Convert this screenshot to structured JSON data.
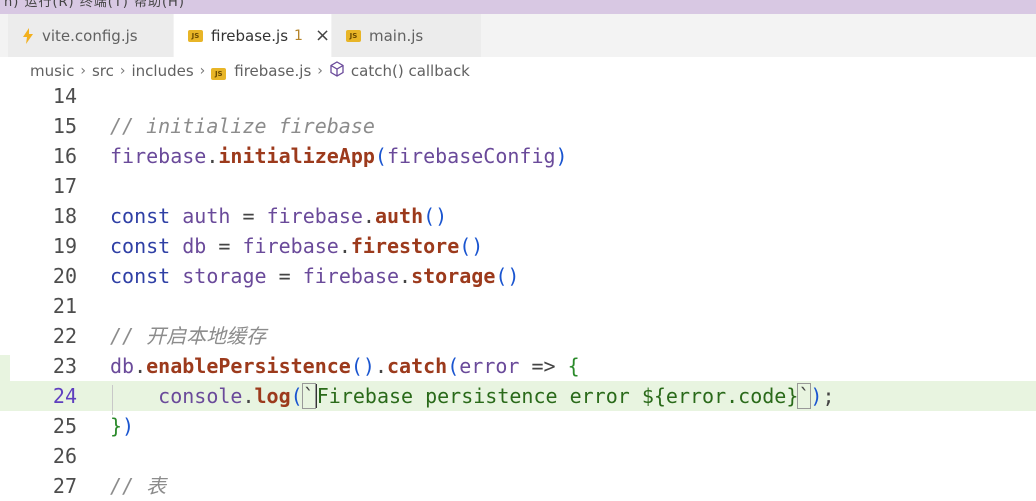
{
  "menubar": {
    "text": "n)  运行(R)  终端(T)  帮助(H)"
  },
  "tabs": [
    {
      "label": "vite.config.js",
      "icon": "vite-bolt-icon",
      "active": false
    },
    {
      "label": "firebase.js",
      "icon": "js-file-icon",
      "active": true,
      "badge": "1",
      "close": "×"
    },
    {
      "label": "main.js",
      "icon": "js-file-icon",
      "active": false
    }
  ],
  "js_icon_text": "JS",
  "breadcrumb": {
    "items": [
      "music",
      "src",
      "includes",
      "firebase.js",
      "catch() callback"
    ],
    "separator": "›"
  },
  "code": {
    "current_line": 24,
    "lines": [
      {
        "n": "14",
        "text": ""
      },
      {
        "n": "15",
        "text": "// initialize firebase"
      },
      {
        "n": "16",
        "text": "firebase.initializeApp(firebaseConfig)"
      },
      {
        "n": "17",
        "text": ""
      },
      {
        "n": "18",
        "text": "const auth = firebase.auth()"
      },
      {
        "n": "19",
        "text": "const db = firebase.firestore()"
      },
      {
        "n": "20",
        "text": "const storage = firebase.storage()"
      },
      {
        "n": "21",
        "text": ""
      },
      {
        "n": "22",
        "text": "// 开启本地缓存"
      },
      {
        "n": "23",
        "text": "db.enablePersistence().catch(error => {"
      },
      {
        "n": "24",
        "text": "    console.log(`Firebase persistence error ${error.code}`);"
      },
      {
        "n": "25",
        "text": "})"
      },
      {
        "n": "26",
        "text": ""
      },
      {
        "n": "27",
        "text": "// 表"
      }
    ]
  },
  "colors": {
    "menubar": "#d8c8e3",
    "current_line": "#e8f4e0",
    "keyword": "#2e3fa5",
    "function": "#9c3a1c",
    "comment": "#8c8c8c"
  }
}
